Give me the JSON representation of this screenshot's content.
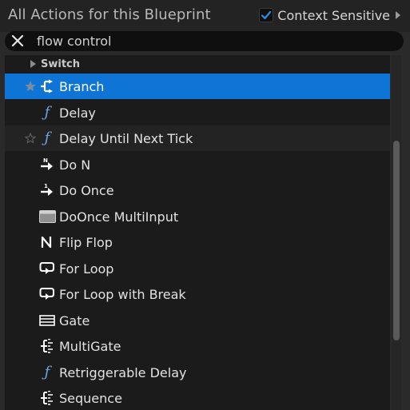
{
  "header": {
    "title": "All Actions for this Blueprint"
  },
  "context_sensitive": {
    "label": "Context Sensitive",
    "checked": true
  },
  "search": {
    "value": "flow control"
  },
  "category": {
    "label": "Switch"
  },
  "items": [
    {
      "label": "Branch",
      "icon": "branch-icon",
      "selected": true,
      "star": true
    },
    {
      "label": "Delay",
      "icon": "function-icon"
    },
    {
      "label": "Delay Until Next Tick",
      "icon": "function-icon",
      "star": true,
      "hover": true
    },
    {
      "label": "Do N",
      "icon": "do-n-icon"
    },
    {
      "label": "Do Once",
      "icon": "do-once-icon"
    },
    {
      "label": "DoOnce MultiInput",
      "icon": "macro-node-icon"
    },
    {
      "label": "Flip Flop",
      "icon": "flip-flop-icon"
    },
    {
      "label": "For Loop",
      "icon": "loop-icon"
    },
    {
      "label": "For Loop with Break",
      "icon": "loop-icon"
    },
    {
      "label": "Gate",
      "icon": "gate-icon"
    },
    {
      "label": "MultiGate",
      "icon": "multigate-icon"
    },
    {
      "label": "Retriggerable Delay",
      "icon": "function-icon"
    },
    {
      "label": "Sequence",
      "icon": "sequence-icon"
    }
  ],
  "colors": {
    "selection": "#0e75d6",
    "function_icon": "#6aa7e6",
    "panel_bg": "#1b1b1b"
  }
}
